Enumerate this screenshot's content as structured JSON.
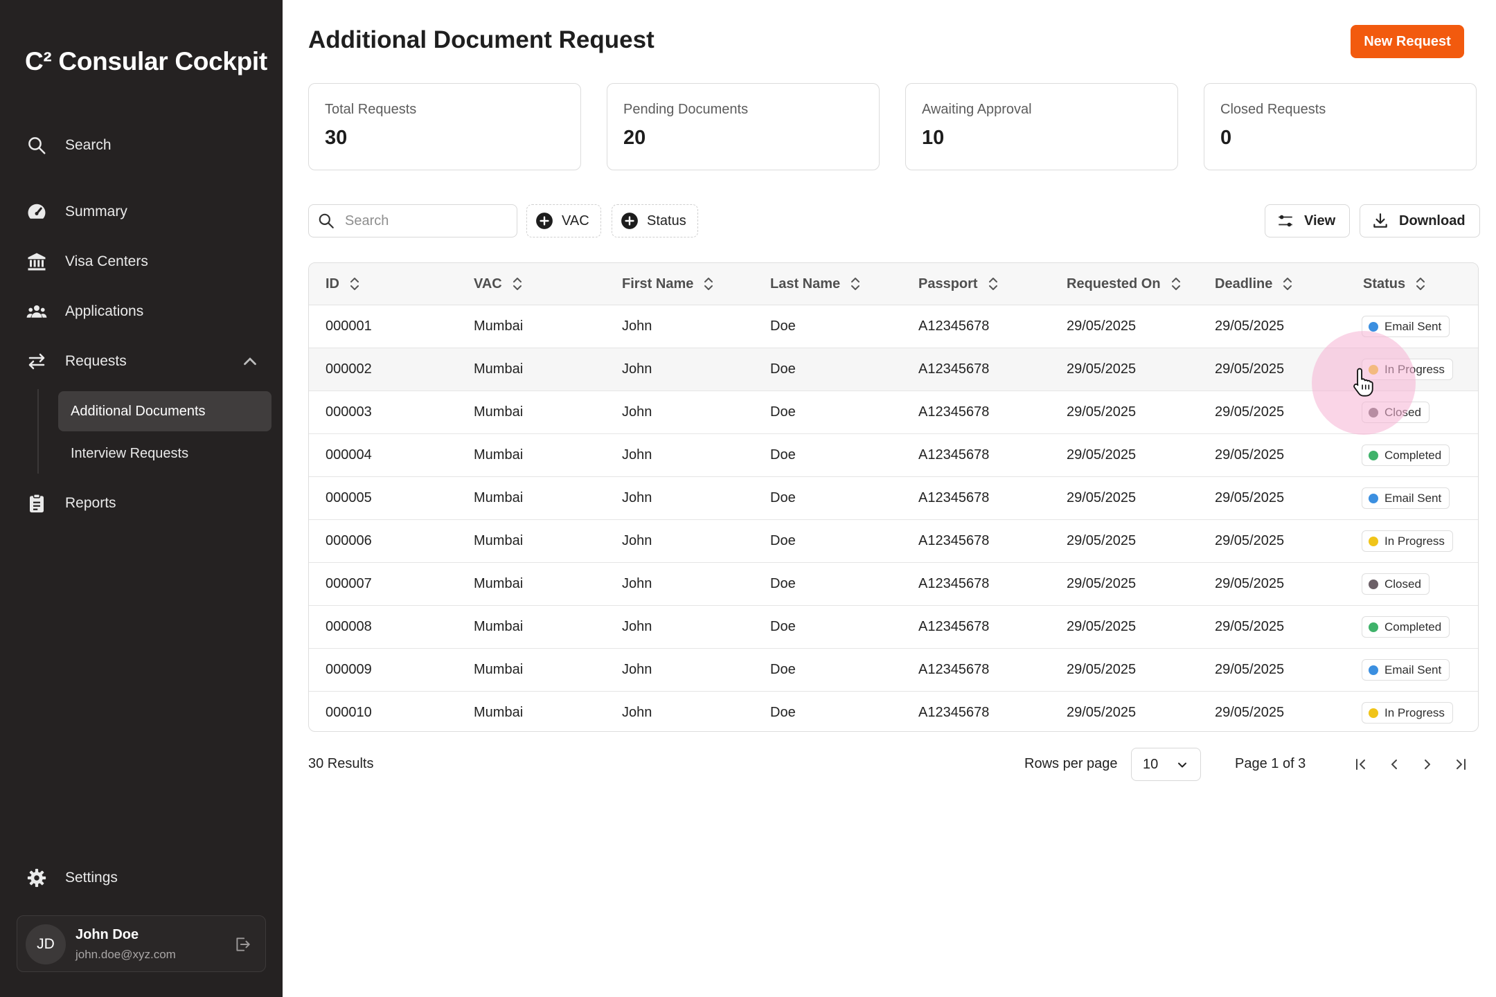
{
  "app": {
    "title": "C² Consular Cockpit"
  },
  "sidebar": {
    "search_label": "Search",
    "items": [
      {
        "label": "Summary",
        "icon": "gauge-icon"
      },
      {
        "label": "Visa Centers",
        "icon": "bank-icon"
      },
      {
        "label": "Applications",
        "icon": "users-icon"
      },
      {
        "label": "Requests",
        "icon": "swap-arrows-icon",
        "expanded": true
      },
      {
        "label": "Reports",
        "icon": "clipboard-icon"
      }
    ],
    "sub_items": [
      {
        "label": "Additional Documents",
        "active": true
      },
      {
        "label": "Interview Requests",
        "active": false
      }
    ],
    "settings_label": "Settings",
    "user": {
      "initials": "JD",
      "name": "John Doe",
      "email": "john.doe@xyz.com"
    }
  },
  "header": {
    "title": "Additional Document Request",
    "new_button": "New Request"
  },
  "stats": [
    {
      "label": "Total Requests",
      "value": "30"
    },
    {
      "label": "Pending Documents",
      "value": "20"
    },
    {
      "label": "Awaiting Approval",
      "value": "10"
    },
    {
      "label": "Closed Requests",
      "value": "0"
    }
  ],
  "toolbar": {
    "search_placeholder": "Search",
    "filters": [
      "VAC",
      "Status"
    ],
    "view_label": "View",
    "download_label": "Download"
  },
  "table": {
    "columns": [
      "ID",
      "VAC",
      "First Name",
      "Last Name",
      "Passport",
      "Requested On",
      "Deadline",
      "Status"
    ],
    "rows": [
      [
        "000001",
        "Mumbai",
        "John",
        "Doe",
        "A12345678",
        "29/05/2025",
        "29/05/2025",
        "Email Sent"
      ],
      [
        "000002",
        "Mumbai",
        "John",
        "Doe",
        "A12345678",
        "29/05/2025",
        "29/05/2025",
        "In Progress"
      ],
      [
        "000003",
        "Mumbai",
        "John",
        "Doe",
        "A12345678",
        "29/05/2025",
        "29/05/2025",
        "Closed"
      ],
      [
        "000004",
        "Mumbai",
        "John",
        "Doe",
        "A12345678",
        "29/05/2025",
        "29/05/2025",
        "Completed"
      ],
      [
        "000005",
        "Mumbai",
        "John",
        "Doe",
        "A12345678",
        "29/05/2025",
        "29/05/2025",
        "Email Sent"
      ],
      [
        "000006",
        "Mumbai",
        "John",
        "Doe",
        "A12345678",
        "29/05/2025",
        "29/05/2025",
        "In Progress"
      ],
      [
        "000007",
        "Mumbai",
        "John",
        "Doe",
        "A12345678",
        "29/05/2025",
        "29/05/2025",
        "Closed"
      ],
      [
        "000008",
        "Mumbai",
        "John",
        "Doe",
        "A12345678",
        "29/05/2025",
        "29/05/2025",
        "Completed"
      ],
      [
        "000009",
        "Mumbai",
        "John",
        "Doe",
        "A12345678",
        "29/05/2025",
        "29/05/2025",
        "Email Sent"
      ],
      [
        "000010",
        "Mumbai",
        "John",
        "Doe",
        "A12345678",
        "29/05/2025",
        "29/05/2025",
        "In Progress"
      ]
    ],
    "status_colors": {
      "Email Sent": "#3b8fe0",
      "In Progress": "#f0c419",
      "Closed": "#6b5f66",
      "Completed": "#3fb26a"
    }
  },
  "pagination": {
    "results": "30 Results",
    "rows_per_page_label": "Rows per page",
    "rows_per_page_value": "10",
    "page_info": "Page 1 of 3"
  },
  "colors": {
    "sidebar_bg": "#252222",
    "accent": "#f25a0e"
  }
}
